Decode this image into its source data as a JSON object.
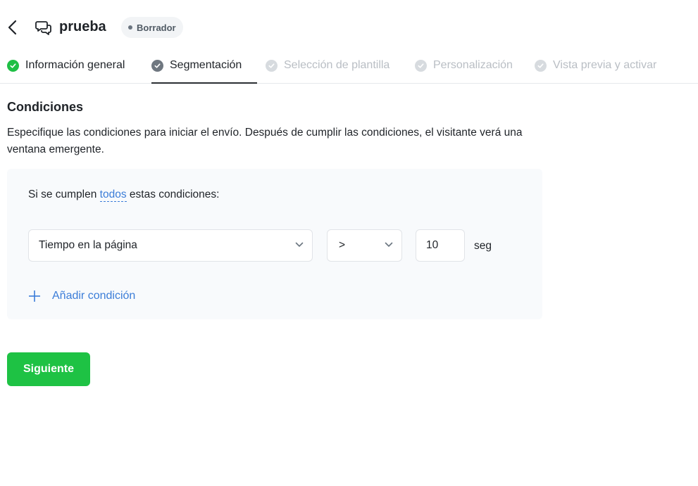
{
  "header": {
    "title": "prueba",
    "status_badge": "Borrador"
  },
  "tabs": [
    {
      "label": "Información general",
      "state": "done"
    },
    {
      "label": "Segmentación",
      "state": "active"
    },
    {
      "label": "Selección de plantilla",
      "state": "pending"
    },
    {
      "label": "Personalización",
      "state": "pending"
    },
    {
      "label": "Vista previa y activar",
      "state": "pending"
    }
  ],
  "section": {
    "title": "Condiciones",
    "description": "Especifique las condiciones para iniciar el envío. Después de cumplir las condiciones, el visitante verá una ventana emergente."
  },
  "conditions": {
    "intro_prefix": "Si se cumplen",
    "match_mode": "todos",
    "intro_suffix": "estas condiciones:",
    "rule": {
      "field": "Tiempo en la página",
      "operator": ">",
      "value": "10",
      "unit": "seg"
    },
    "add_label": "Añadir condición"
  },
  "footer": {
    "next_label": "Siguiente"
  },
  "colors": {
    "accent_green": "#1ec244",
    "link_blue": "#3b7dd8",
    "done_green": "#1fbf45"
  },
  "icons": {
    "back": "chevron-left-icon",
    "campaign": "chat-bubbles-icon",
    "dropdown": "chevron-down-icon",
    "add": "plus-icon",
    "step": "check-circle-icon"
  }
}
